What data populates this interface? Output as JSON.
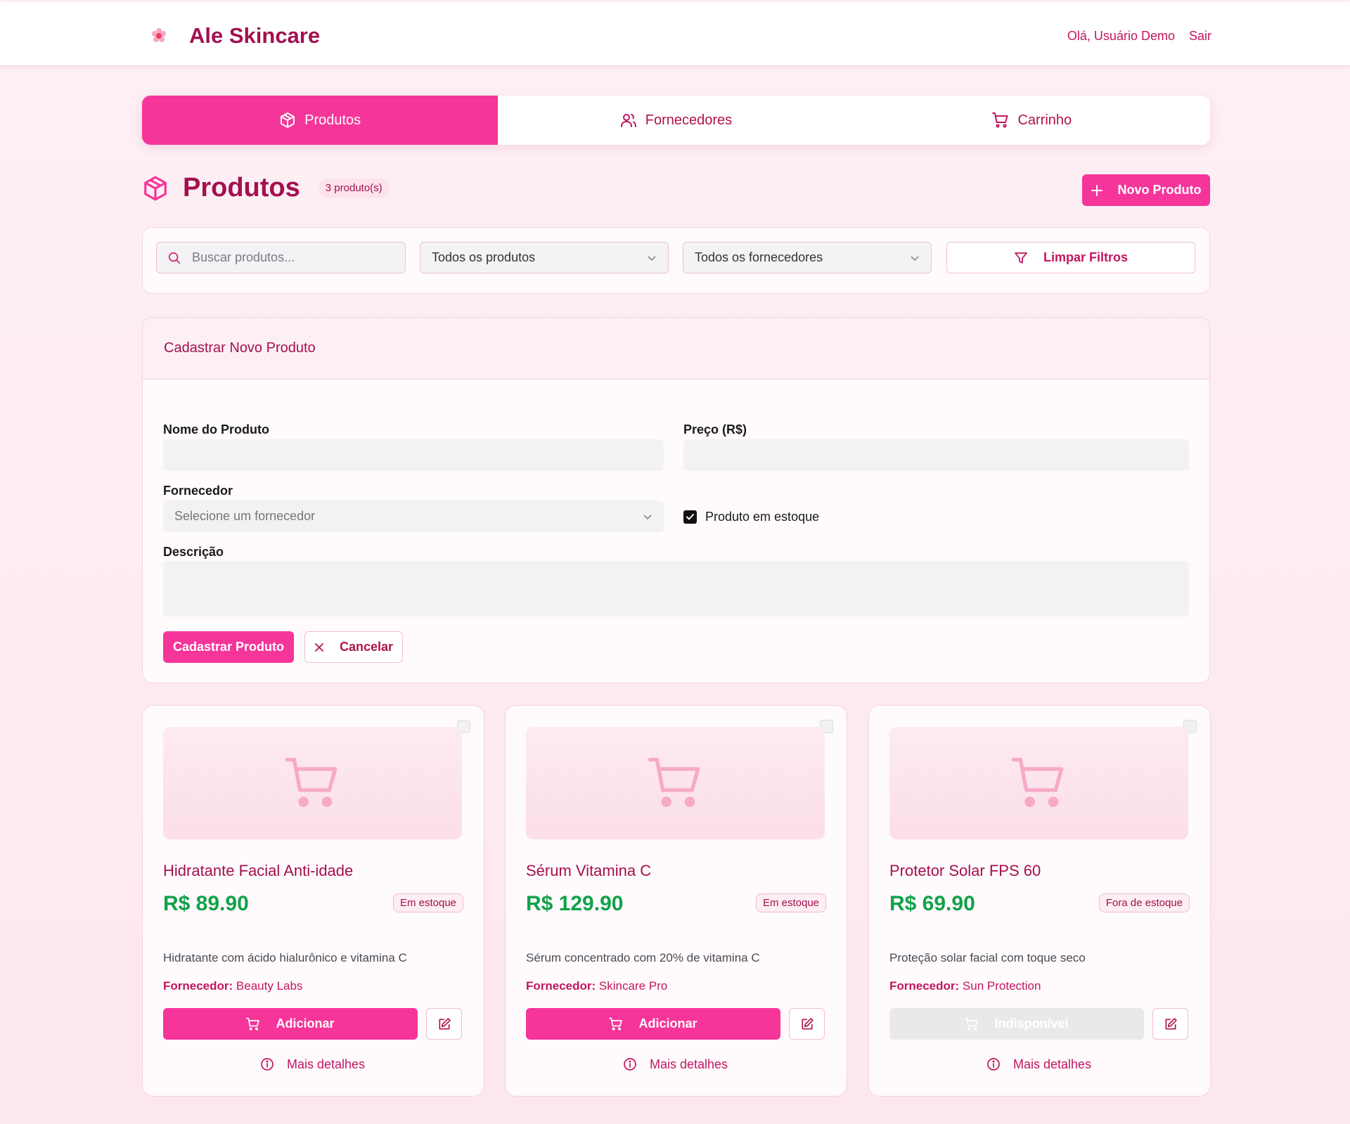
{
  "header": {
    "title": "Ale Skincare",
    "greeting": "Olá, Usuário Demo",
    "logout": "Sair"
  },
  "tabs": [
    {
      "label": "Produtos",
      "icon": "package-icon",
      "active": true
    },
    {
      "label": "Fornecedores",
      "icon": "users-icon",
      "active": false
    },
    {
      "label": "Carrinho",
      "icon": "cart-icon",
      "active": false
    }
  ],
  "section": {
    "title": "Produtos",
    "count_badge": "3 produto(s)",
    "new_button": "Novo Produto"
  },
  "filters": {
    "search_placeholder": "Buscar produtos...",
    "search_value": "",
    "stock_filter": "Todos os produtos",
    "supplier_filter": "Todos os fornecedores",
    "clear_button": "Limpar Filtros"
  },
  "form": {
    "heading": "Cadastrar Novo Produto",
    "name_label": "Nome do Produto",
    "name_value": "",
    "price_label": "Preço (R$)",
    "price_value": "",
    "supplier_label": "Fornecedor",
    "supplier_placeholder": "Selecione um fornecedor",
    "in_stock_label": "Produto em estoque",
    "in_stock_checked": true,
    "description_label": "Descrição",
    "description_value": "",
    "submit_button": "Cadastrar Produto",
    "cancel_button": "Cancelar"
  },
  "products": [
    {
      "name": "Hidratante Facial Anti-idade",
      "price": "R$ 89.90",
      "stock_status": "Em estoque",
      "description": "Hidratante com ácido hialurônico e vitamina C",
      "supplier_label": "Fornecedor:",
      "supplier": "Beauty Labs",
      "action_label": "Adicionar",
      "available": true,
      "more_label": "Mais detalhes"
    },
    {
      "name": "Sérum Vitamina C",
      "price": "R$ 129.90",
      "stock_status": "Em estoque",
      "description": "Sérum concentrado com 20% de vitamina C",
      "supplier_label": "Fornecedor:",
      "supplier": "Skincare Pro",
      "action_label": "Adicionar",
      "available": true,
      "more_label": "Mais detalhes"
    },
    {
      "name": "Protetor Solar FPS 60",
      "price": "R$ 69.90",
      "stock_status": "Fora de estoque",
      "description": "Proteção solar facial com toque seco",
      "supplier_label": "Fornecedor:",
      "supplier": "Sun Protection",
      "action_label": "Indisponível",
      "available": false,
      "more_label": "Mais detalhes"
    }
  ],
  "colors": {
    "brand": "#a3104f",
    "accent": "#f5359a",
    "price": "#11a24a",
    "background": "#fdf0f4"
  }
}
